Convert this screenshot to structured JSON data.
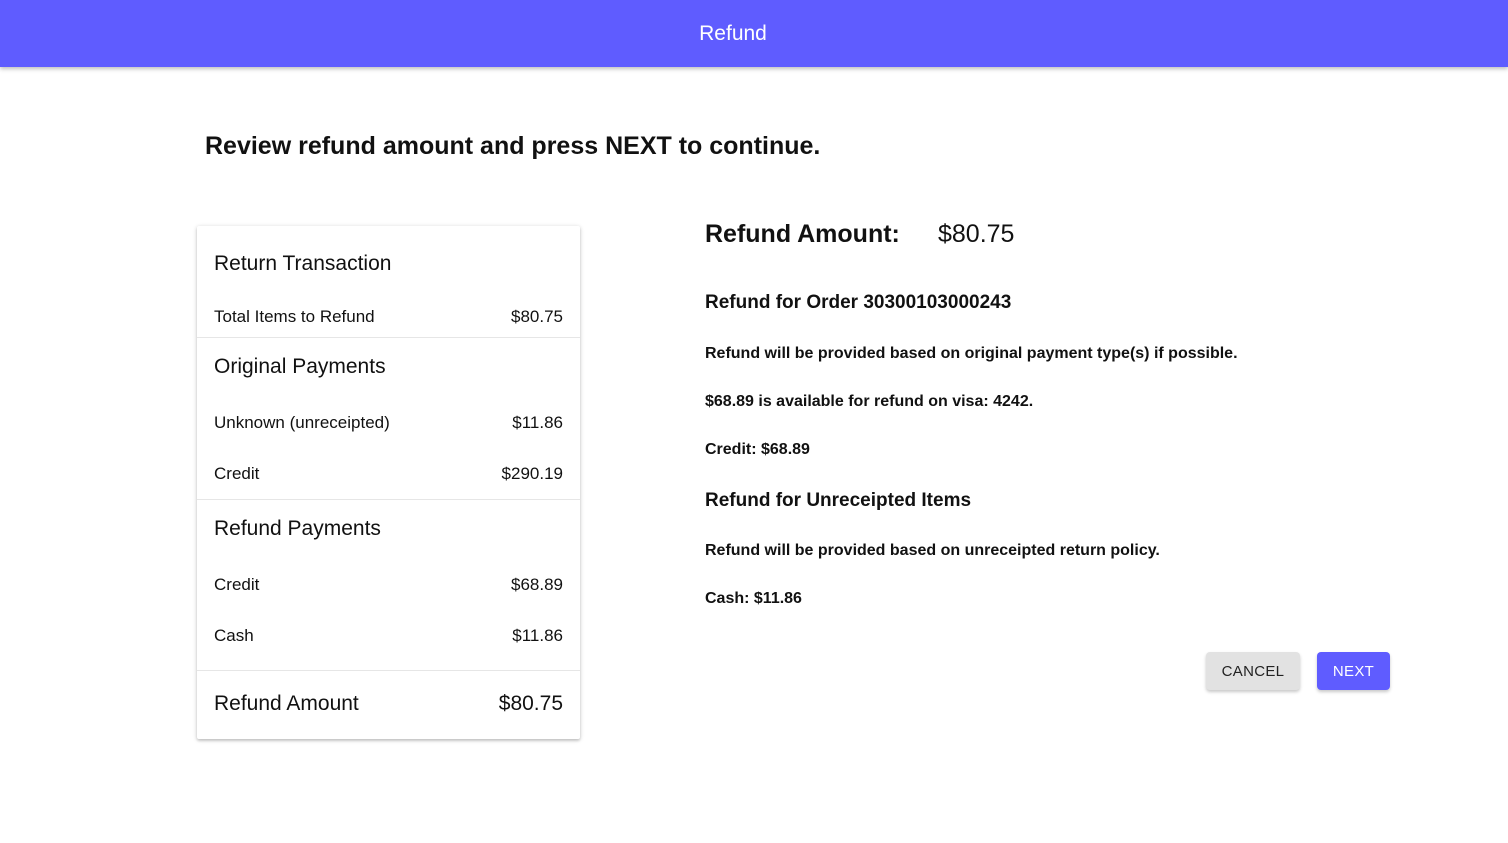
{
  "app_bar": {
    "title": "Refund"
  },
  "instruction": "Review refund amount and press NEXT to continue.",
  "summary": {
    "return_transaction": {
      "title": "Return Transaction",
      "rows": [
        {
          "label": "Total Items to Refund",
          "value": "$80.75"
        }
      ]
    },
    "original_payments": {
      "title": "Original Payments",
      "rows": [
        {
          "label": "Unknown (unreceipted)",
          "value": "$11.86"
        },
        {
          "label": "Credit",
          "value": "$290.19"
        }
      ]
    },
    "refund_payments": {
      "title": "Refund Payments",
      "rows": [
        {
          "label": "Credit",
          "value": "$68.89"
        },
        {
          "label": "Cash",
          "value": "$11.86"
        }
      ]
    },
    "total": {
      "label": "Refund Amount",
      "value": "$80.75"
    }
  },
  "details": {
    "refund_amount_label": "Refund Amount:",
    "refund_amount_value": "$80.75",
    "order_heading": "Refund for Order 30300103000243",
    "order_policy": "Refund will be provided based on original payment type(s) if possible.",
    "order_available": "$68.89 is available for refund on visa: 4242.",
    "order_credit": "Credit: $68.89",
    "unreceipted_heading": "Refund for Unreceipted Items",
    "unreceipted_policy": "Refund will be provided based on unreceipted return policy.",
    "unreceipted_cash": "Cash: $11.86"
  },
  "buttons": {
    "cancel": "CANCEL",
    "next": "NEXT"
  },
  "colors": {
    "primary": "#5f5cff",
    "cancel_bg": "#e2e2e2"
  }
}
